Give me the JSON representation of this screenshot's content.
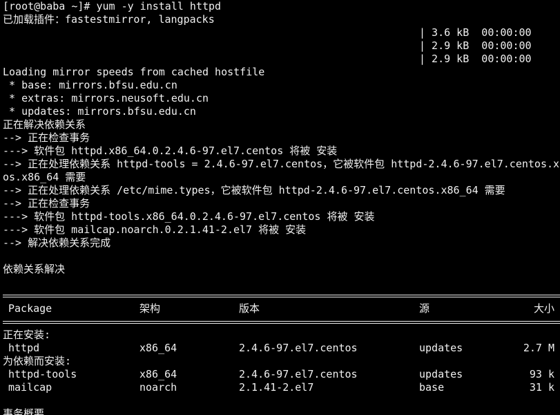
{
  "terminal": {
    "prompt_line": "[root@baba ~]# yum -y install httpd",
    "plugins_line": "已加载插件：fastestmirror, langpacks",
    "repos": [
      {
        "name": "base",
        "info": "| 3.6 kB  00:00:00"
      },
      {
        "name": "extras",
        "info": "| 2.9 kB  00:00:00"
      },
      {
        "name": "updates",
        "info": "| 2.9 kB  00:00:00"
      }
    ],
    "log_lines": [
      "Loading mirror speeds from cached hostfile",
      " * base: mirrors.bfsu.edu.cn",
      " * extras: mirrors.neusoft.edu.cn",
      " * updates: mirrors.bfsu.edu.cn",
      "正在解决依赖关系",
      "--> 正在检查事务",
      "---> 软件包 httpd.x86_64.0.2.4.6-97.el7.centos 将被 安装",
      "--> 正在处理依赖关系 httpd-tools = 2.4.6-97.el7.centos，它被软件包 httpd-2.4.6-97.el7.centos.x86_64 需要",
      "os.x86_64 需要",
      "--> 正在处理依赖关系 /etc/mime.types，它被软件包 httpd-2.4.6-97.el7.centos.x86_64 需要",
      "--> 正在检查事务",
      "---> 软件包 httpd-tools.x86_64.0.2.4.6-97.el7.centos 将被 安装",
      "---> 软件包 mailcap.noarch.0.2.1.41-2.el7 将被 安装",
      "--> 解决依赖关系完成",
      "",
      "依赖关系解决"
    ],
    "table": {
      "headers": {
        "package": "Package",
        "arch": "架构",
        "version": "版本",
        "repo": "源",
        "size": "大小"
      },
      "installing_label": "正在安装:",
      "installing_rows": [
        {
          "package": "httpd",
          "arch": "x86_64",
          "version": "2.4.6-97.el7.centos",
          "repo": "updates",
          "size": "2.7 M"
        }
      ],
      "dep_label": "为依赖而安装:",
      "dep_rows": [
        {
          "package": "httpd-tools",
          "arch": "x86_64",
          "version": "2.4.6-97.el7.centos",
          "repo": "updates",
          "size": "93 k"
        },
        {
          "package": "mailcap",
          "arch": "noarch",
          "version": "2.1.41-2.el7",
          "repo": "base",
          "size": "31 k"
        }
      ]
    },
    "summary_label": "事务概要"
  }
}
